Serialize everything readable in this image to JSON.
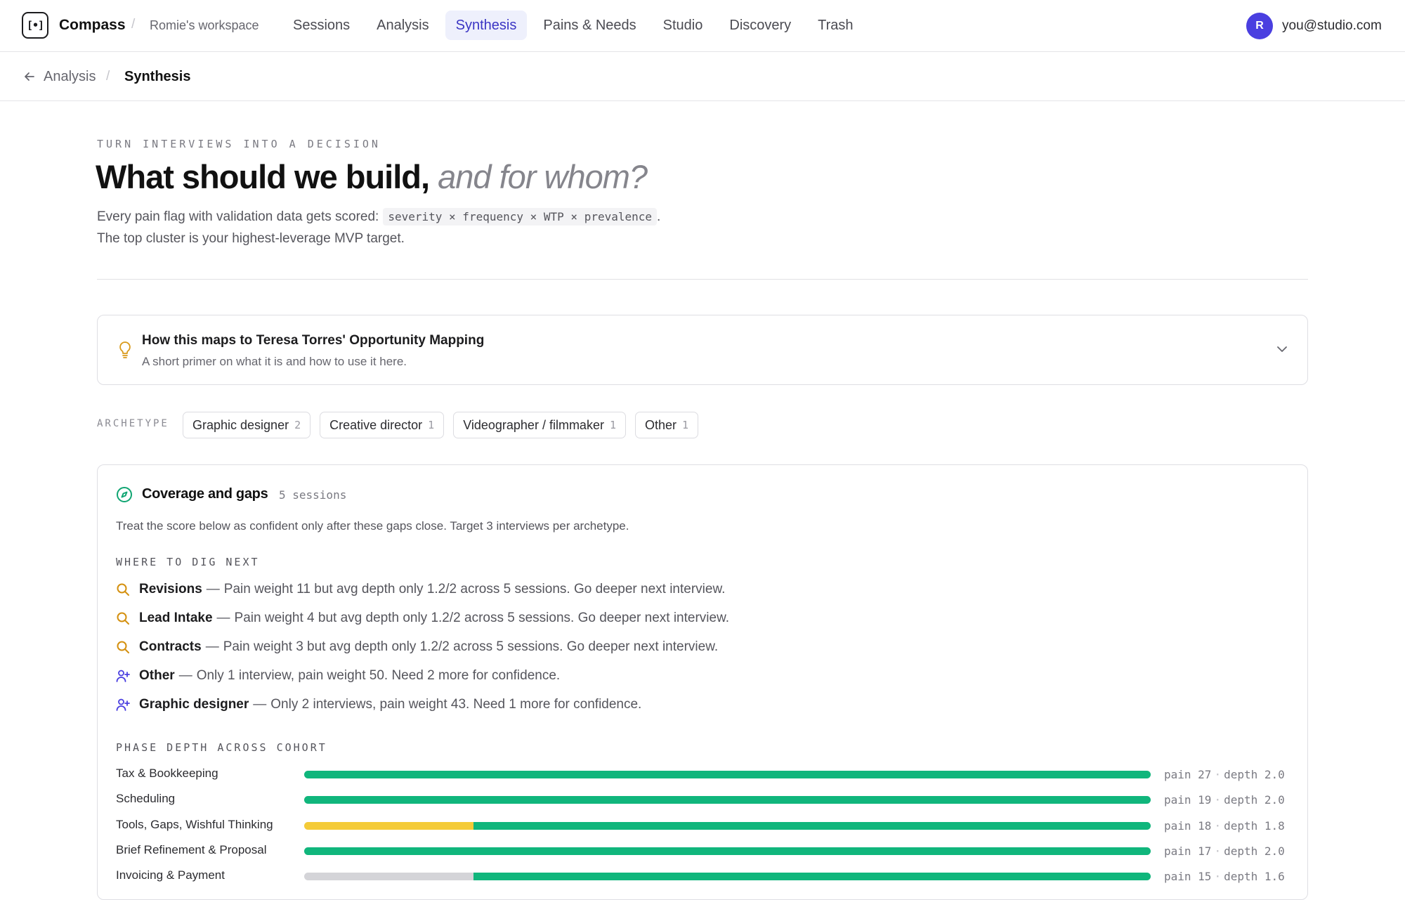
{
  "app": {
    "brand": "Compass",
    "logo_glyph": "[•]",
    "workspace": "Romie's workspace",
    "separator": "/"
  },
  "nav": {
    "items": [
      {
        "label": "Sessions",
        "active": false
      },
      {
        "label": "Analysis",
        "active": false
      },
      {
        "label": "Synthesis",
        "active": true
      },
      {
        "label": "Pains & Needs",
        "active": false
      },
      {
        "label": "Studio",
        "active": false
      },
      {
        "label": "Discovery",
        "active": false
      },
      {
        "label": "Trash",
        "active": false
      }
    ]
  },
  "user": {
    "initial": "R",
    "email": "you@studio.com",
    "avatar_color": "#4a3fe0"
  },
  "breadcrumb": {
    "parent": "Analysis",
    "separator": "/",
    "current": "Synthesis"
  },
  "hero": {
    "eyebrow": "TURN INTERVIEWS INTO A DECISION",
    "title_main": "What should we build,",
    "title_accent": "and for whom?",
    "lede_prefix": "Every pain flag with validation data gets scored:",
    "formula": "severity × frequency × WTP × prevalence",
    "lede_suffix": ".",
    "lede_line2": "The top cluster is your highest-leverage MVP target."
  },
  "primer": {
    "icon": "lightbulb-icon",
    "title": "How this maps to Teresa Torres' Opportunity Mapping",
    "subtitle": "A short primer on what it is and how to use it here."
  },
  "archetype": {
    "label": "ARCHETYPE",
    "chips": [
      {
        "label": "Graphic designer",
        "count": "2"
      },
      {
        "label": "Creative director",
        "count": "1"
      },
      {
        "label": "Videographer / filmmaker",
        "count": "1"
      },
      {
        "label": "Other",
        "count": "1"
      }
    ]
  },
  "coverage": {
    "icon": "compass-icon",
    "title": "Coverage and gaps",
    "count": "5 sessions",
    "description": "Treat the score below as confident only after these gaps close. Target 3 interviews per archetype.",
    "dig_label": "WHERE TO DIG NEXT",
    "dig_items": [
      {
        "icon": "search-icon",
        "name": "Revisions",
        "text": "Pain weight 11 but avg depth only 1.2/2 across 5 sessions. Go deeper next interview."
      },
      {
        "icon": "search-icon",
        "name": "Lead Intake",
        "text": "Pain weight 4 but avg depth only 1.2/2 across 5 sessions. Go deeper next interview."
      },
      {
        "icon": "search-icon",
        "name": "Contracts",
        "text": "Pain weight 3 but avg depth only 1.2/2 across 5 sessions. Go deeper next interview."
      },
      {
        "icon": "user-plus-icon",
        "name": "Other",
        "text": "Only 1 interview, pain weight 50. Need 2 more for confidence."
      },
      {
        "icon": "user-plus-icon",
        "name": "Graphic designer",
        "text": "Only 2 interviews, pain weight 43. Need 1 more for confidence."
      }
    ],
    "dash": "—",
    "phase_label": "PHASE DEPTH ACROSS COHORT",
    "phases": [
      {
        "name": "Tax & Bookkeeping",
        "pain": "pain 27",
        "depth": "depth 2.0",
        "deep_fraction": 1.0,
        "shallow_fraction": 0.0,
        "gray_fraction": 0.0
      },
      {
        "name": "Scheduling",
        "pain": "pain 19",
        "depth": "depth 2.0",
        "deep_fraction": 1.0,
        "shallow_fraction": 0.0,
        "gray_fraction": 0.0
      },
      {
        "name": "Tools, Gaps, Wishful Thinking",
        "pain": "pain 18",
        "depth": "depth 1.8",
        "deep_fraction": 0.8,
        "shallow_fraction": 0.2,
        "gray_fraction": 0.0
      },
      {
        "name": "Brief Refinement & Proposal",
        "pain": "pain 17",
        "depth": "depth 2.0",
        "deep_fraction": 1.0,
        "shallow_fraction": 0.0,
        "gray_fraction": 0.0
      },
      {
        "name": "Invoicing & Payment",
        "pain": "pain 15",
        "depth": "depth 1.6",
        "deep_fraction": 0.8,
        "shallow_fraction": 0.0,
        "gray_fraction": 0.2
      }
    ],
    "colors": {
      "deep": "#10b67c",
      "shallow": "#f4cb38",
      "none": "#d4d4d8"
    }
  }
}
